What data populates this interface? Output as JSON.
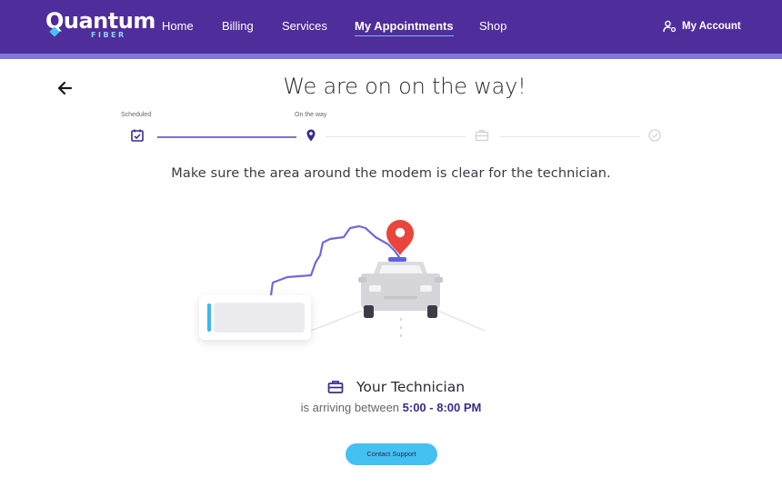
{
  "brand": {
    "name": "Quantum",
    "tagline": "FIBER"
  },
  "nav": {
    "home": "Home",
    "billing": "Billing",
    "services": "Services",
    "appointments": "My Appointments",
    "shop": "Shop",
    "account": "My Account"
  },
  "page": {
    "title": "We are on on the way!",
    "instruction": "Make sure the area around the modem is clear for the technician."
  },
  "progress": {
    "steps": [
      {
        "label": "Scheduled",
        "icon": "calendar-check-icon",
        "status": "complete"
      },
      {
        "label": "On the way",
        "icon": "map-pin-icon",
        "status": "current"
      },
      {
        "label": "",
        "icon": "toolbox-icon",
        "status": "pending"
      },
      {
        "label": "",
        "icon": "check-circle-icon",
        "status": "pending"
      }
    ]
  },
  "technician": {
    "heading": "Your Technician",
    "arrival_prefix": "is arriving between ",
    "arrival_window": "5:00 - 8:00 PM"
  },
  "support": {
    "label": "Contact Support"
  },
  "colors": {
    "header_bg": "#4f2d9b",
    "header_accent": "#7f77d9",
    "route": "#6e6ad2",
    "pin": "#e8453c",
    "button": "#45c0f2",
    "highlight_text": "#3a2c8c"
  }
}
